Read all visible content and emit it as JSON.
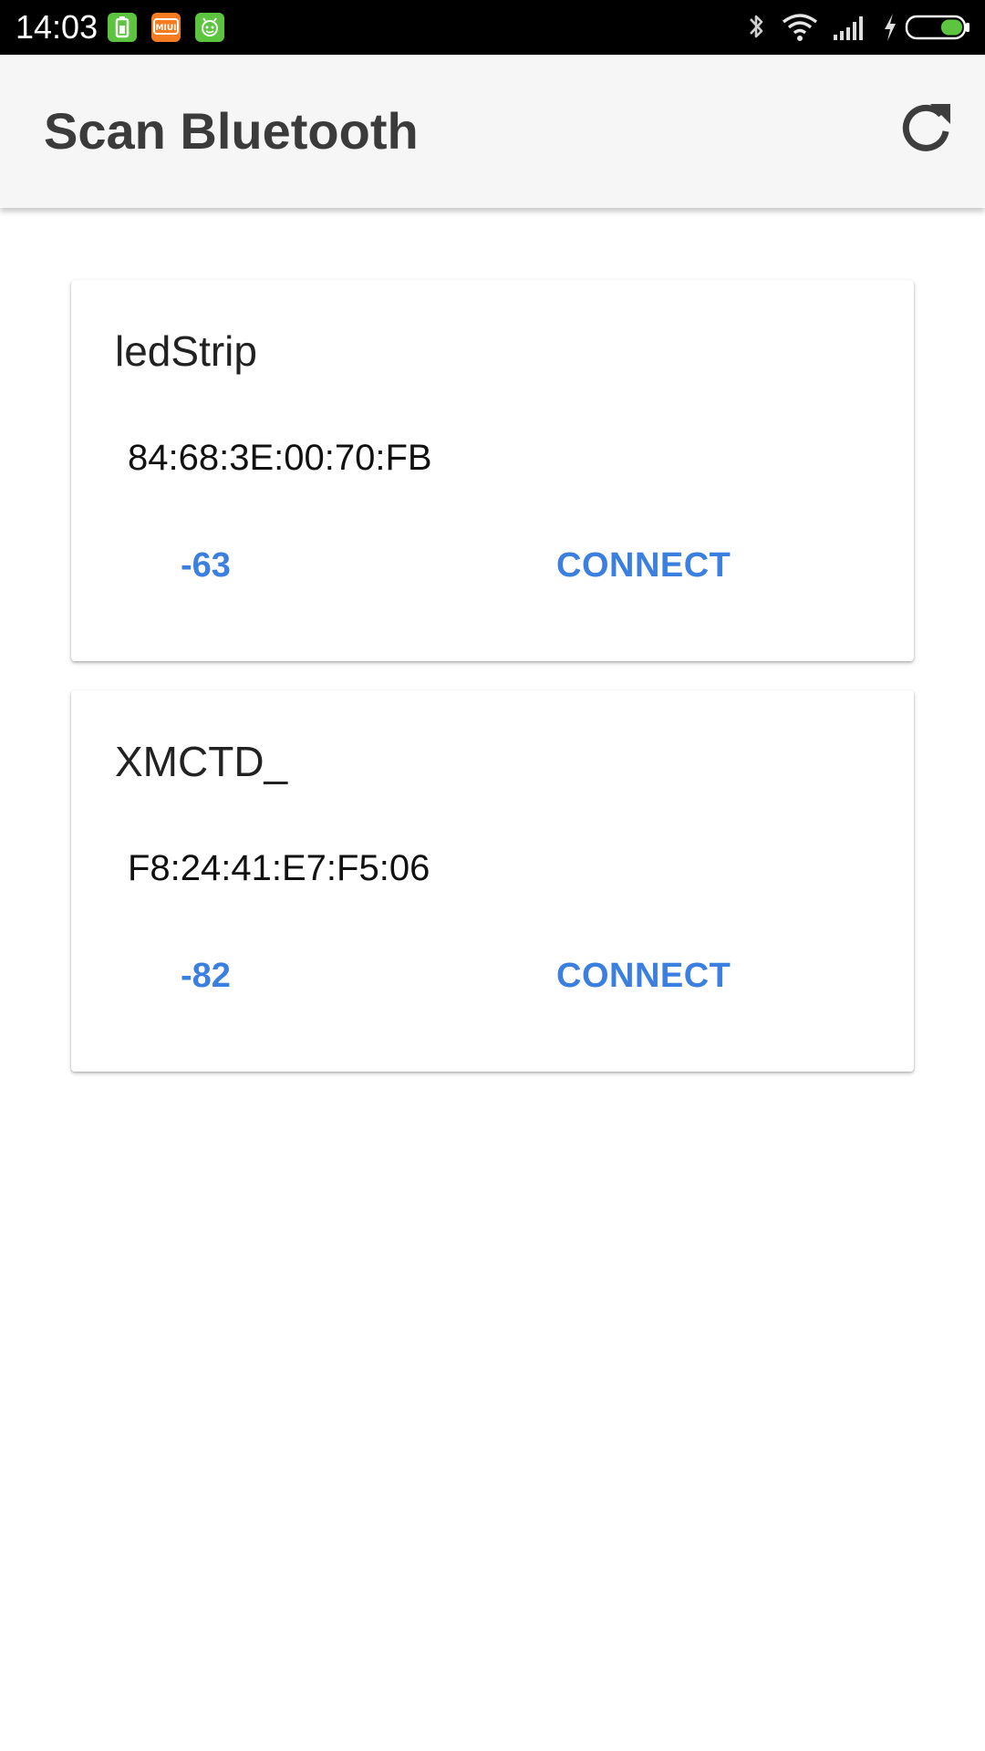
{
  "status_bar": {
    "time": "14:03",
    "notification_icons": [
      {
        "name": "battery-app-icon",
        "color": "#5cc43e",
        "glyph": "▮"
      },
      {
        "name": "miui-icon",
        "color": "#f57c20",
        "glyph": "MIUI"
      },
      {
        "name": "android-app-icon",
        "color": "#5cc43e",
        "glyph": "☺"
      }
    ],
    "system_icons": [
      "bluetooth-icon",
      "wifi-icon",
      "signal-icon",
      "charging-icon",
      "battery-icon"
    ],
    "battery_level": 0.22
  },
  "app_bar": {
    "title": "Scan Bluetooth",
    "action_icon": "refresh-icon"
  },
  "devices": [
    {
      "name": "ledStrip",
      "mac": "84:68:3E:00:70:FB",
      "rssi": "-63",
      "action_label": "CONNECT"
    },
    {
      "name": "XMCTD_",
      "mac": "F8:24:41:E7:F5:06",
      "rssi": "-82",
      "action_label": "CONNECT"
    }
  ],
  "colors": {
    "accent": "#3b7fe0",
    "app_bar_bg": "#f6f6f6",
    "title_text": "#3b3b3b"
  }
}
